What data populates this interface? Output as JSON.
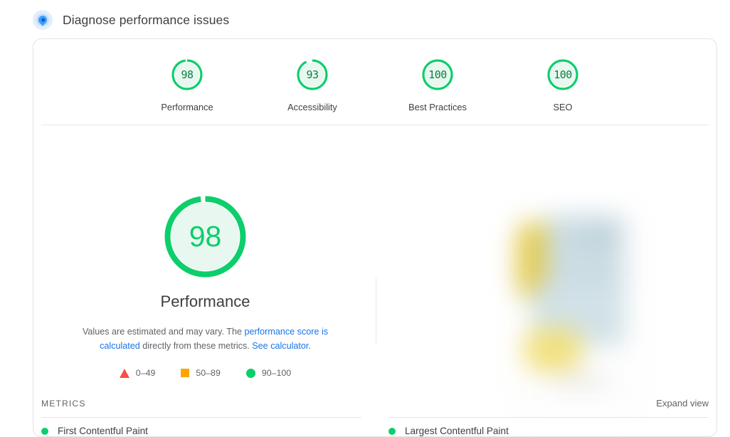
{
  "header": {
    "icon": "lighthouse-icon",
    "title": "Diagnose performance issues"
  },
  "scores": [
    {
      "value": "98",
      "label": "Performance",
      "percent": 98
    },
    {
      "value": "93",
      "label": "Accessibility",
      "percent": 93
    },
    {
      "value": "100",
      "label": "Best Practices",
      "percent": 100
    },
    {
      "value": "100",
      "label": "SEO",
      "percent": 100
    }
  ],
  "featured": {
    "value": "98",
    "label": "Performance",
    "percent": 98,
    "description_pre": "Values are estimated and may vary. The ",
    "description_link1": "performance score is calculated",
    "description_mid": " directly from these metrics. ",
    "description_link2": "See calculator",
    "description_post": "."
  },
  "legend": [
    {
      "shape": "triangle-icon",
      "label": "0–49",
      "color": "#ff4e42"
    },
    {
      "shape": "square-icon",
      "label": "50–89",
      "color": "#ffa400"
    },
    {
      "shape": "circle-icon",
      "label": "90–100",
      "color": "#0cce6b"
    }
  ],
  "metrics_section": {
    "title": "METRICS",
    "expand_label": "Expand view",
    "items": [
      {
        "name": "First Contentful Paint",
        "status_color": "#0cce6b"
      },
      {
        "name": "Largest Contentful Paint",
        "status_color": "#0cce6b"
      }
    ]
  },
  "colors": {
    "pass_green": "#0cce6b",
    "pass_green_fill": "#e8f8f0",
    "score_text_green": "#0a8043",
    "link_blue": "#1a73e8",
    "average_orange": "#ffa400",
    "fail_red": "#ff4e42",
    "text_primary": "#3c4043",
    "text_secondary": "#5f6368",
    "card_border": "#e3e3e3"
  }
}
